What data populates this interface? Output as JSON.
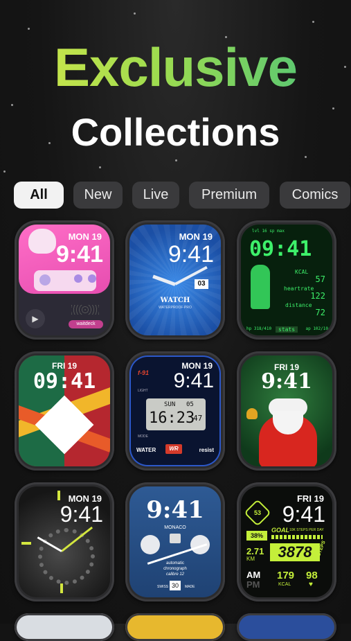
{
  "header": {
    "title_line1": "Exclusive",
    "title_line2": "Collections"
  },
  "filters": [
    {
      "label": "All",
      "active": true
    },
    {
      "label": "New",
      "active": false
    },
    {
      "label": "Live",
      "active": false
    },
    {
      "label": "Premium",
      "active": false
    },
    {
      "label": "Comics",
      "active": false
    }
  ],
  "faces": [
    {
      "date": "MON 19",
      "time": "9:41",
      "brand": "waitdeck"
    },
    {
      "date": "MON 19",
      "time": "9:41",
      "day_num": "03",
      "brand": "WATCH",
      "sub": "WATERPROOF·PRO"
    },
    {
      "time": "09:41",
      "top": "lvl 16  sp max",
      "kcal_label": "KCAL",
      "kcal": "57",
      "heart_label": "heartrate",
      "heart": "122",
      "dist_label": "distance",
      "dist": "72",
      "footer_left": "hp 318/410",
      "footer_mid": "stats",
      "footer_right": "ap 102/10"
    },
    {
      "date": "FRI 19",
      "time": "09:41"
    },
    {
      "date": "MON 19",
      "time": "9:41",
      "lcd_day": "SUN",
      "lcd_date": "05",
      "lcd_time": "16:23",
      "lcd_sec": "47",
      "top_label": "f-91",
      "light": "LIGHT",
      "mode": "MODE",
      "water": "WATER",
      "wr": "WR",
      "resist": "resist"
    },
    {
      "date": "FRI 19",
      "time": "9:41"
    },
    {
      "date": "MON 19",
      "time": "9:41"
    },
    {
      "time": "9:41",
      "brand": "MONACO",
      "auto": "automatic",
      "chrono": "chronograph",
      "calibre": "calibre 12",
      "swiss": "SWISS",
      "made": "MADE",
      "day": "30"
    },
    {
      "date": "FRI 19",
      "time": "9:41",
      "ring": "53",
      "pct": "38%",
      "goal": "GOAL",
      "steps_label": "10K STEPS PER DAY",
      "km": "2.71",
      "km_unit": "KM",
      "steps": "3878",
      "steps_side": "STEPS",
      "am": "AM",
      "pm": "PM",
      "kcal": "179",
      "kcal_unit": "KCAL",
      "heart": "98"
    }
  ],
  "colors": {
    "accent_green": "#46c17c",
    "accent_yellow": "#d7e84a",
    "pip_green": "#3df06a",
    "watch_blue": "#1e5fb8"
  }
}
